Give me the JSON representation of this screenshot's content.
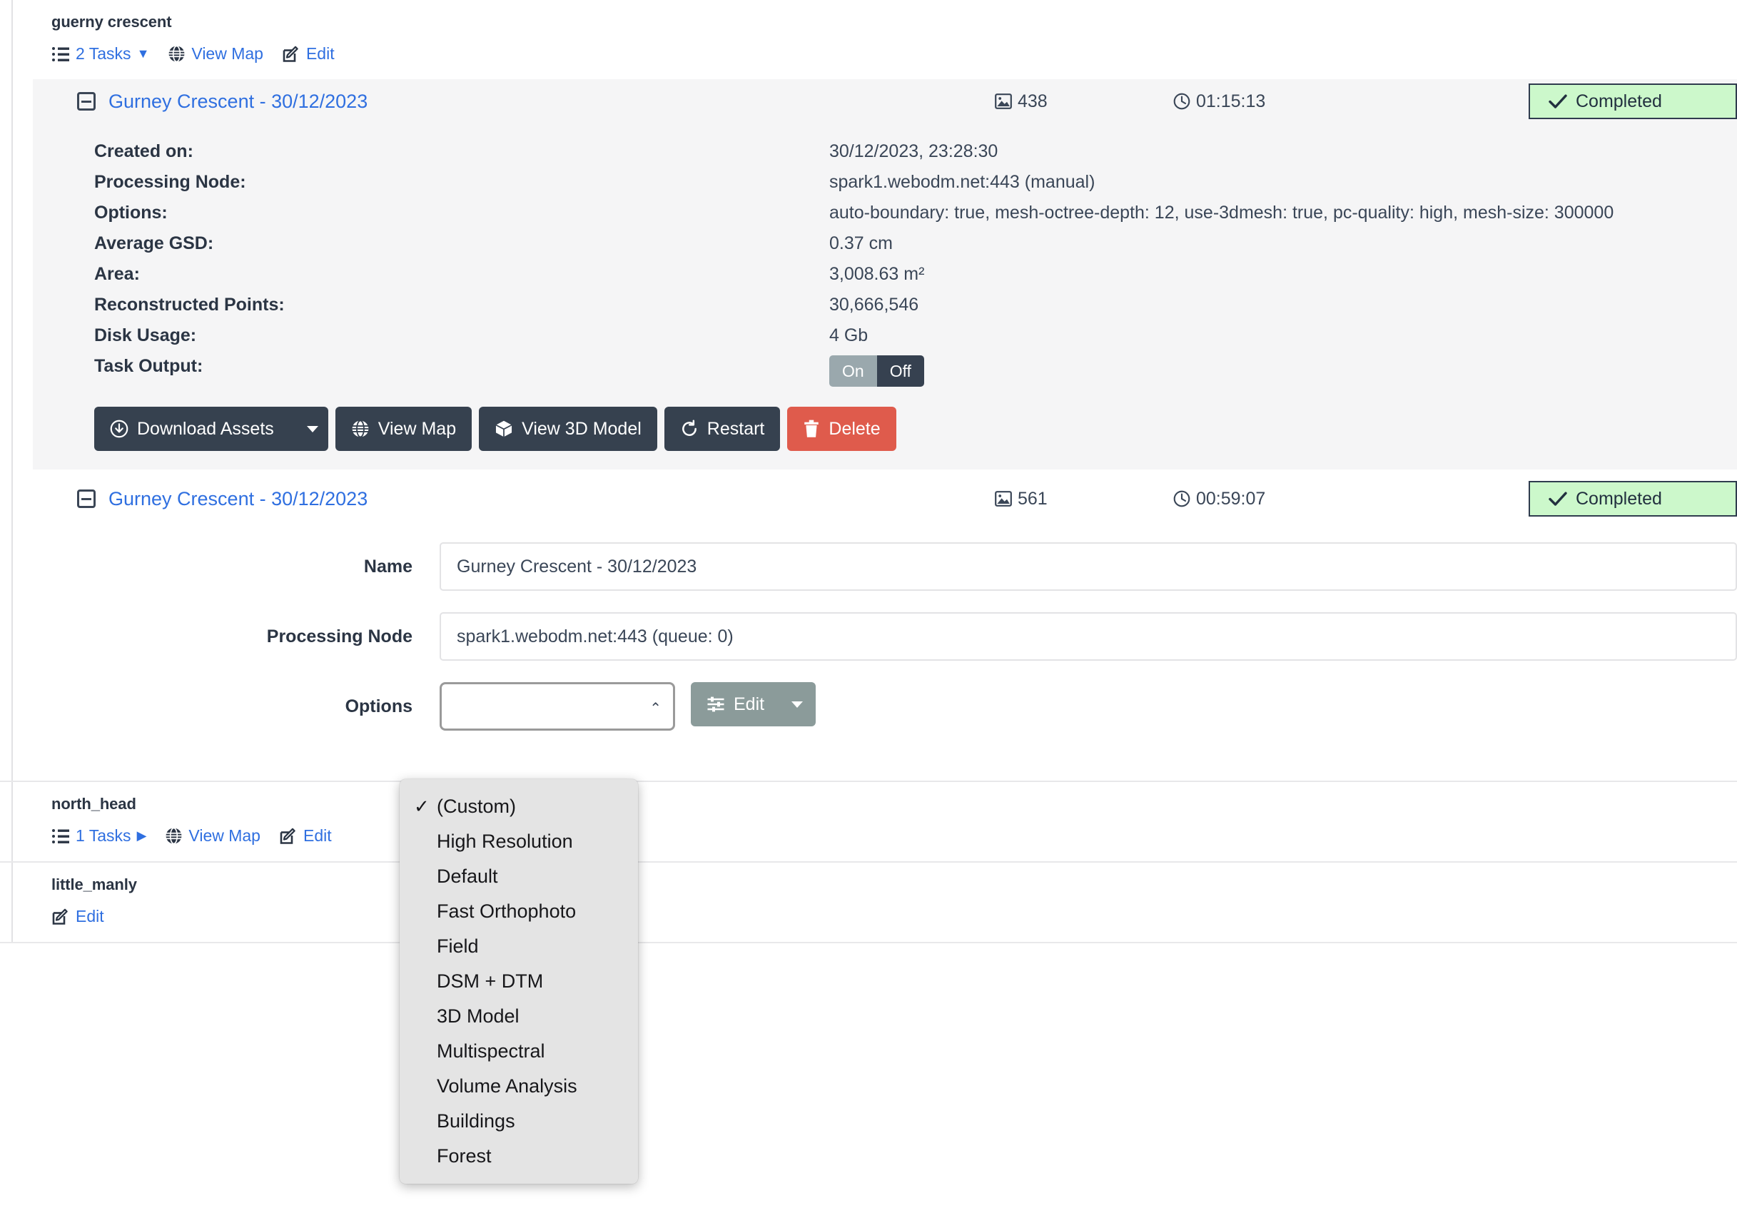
{
  "projects": [
    {
      "name": "guerny crescent",
      "tasks_label": "2 Tasks",
      "tasks_caret": "▼",
      "view_map_label": "View Map",
      "edit_label": "Edit",
      "expanded": true
    },
    {
      "name": "north_head",
      "tasks_label": "1 Tasks",
      "tasks_caret": "▶",
      "view_map_label": "View Map",
      "edit_label": "Edit",
      "expanded": false
    },
    {
      "name": "little_manly",
      "edit_label": "Edit"
    }
  ],
  "task_one": {
    "title": "Gurney Crescent - 30/12/2023",
    "image_count": "438",
    "duration": "01:15:13",
    "status": "Completed",
    "status_color": "#ccf8cb",
    "details": [
      {
        "label": "Created on:",
        "value": "30/12/2023, 23:28:30"
      },
      {
        "label": "Processing Node:",
        "value": "spark1.webodm.net:443 (manual)"
      },
      {
        "label": "Options:",
        "value": "auto-boundary: true, mesh-octree-depth: 12, use-3dmesh: true, pc-quality: high, mesh-size: 300000"
      },
      {
        "label": "Average GSD:",
        "value": "0.37 cm"
      },
      {
        "label": "Area:",
        "value": "3,008.63 m²"
      },
      {
        "label": "Reconstructed Points:",
        "value": "30,666,546"
      },
      {
        "label": "Disk Usage:",
        "value": "4 Gb"
      }
    ],
    "task_output_label": "Task Output:",
    "toggle": {
      "on_label": "On",
      "off_label": "Off",
      "selected": "Off"
    },
    "buttons": [
      {
        "label": "Download Assets",
        "icon": "download-icon",
        "split": true,
        "style": "dark"
      },
      {
        "label": "View Map",
        "icon": "globe-icon",
        "style": "dark"
      },
      {
        "label": "View 3D Model",
        "icon": "cube-icon",
        "style": "dark"
      },
      {
        "label": "Restart",
        "icon": "restart-icon",
        "style": "dark"
      },
      {
        "label": "Delete",
        "icon": "trash-icon",
        "style": "danger"
      }
    ]
  },
  "task_two": {
    "title": "Gurney Crescent - 30/12/2023",
    "image_count": "561",
    "duration": "00:59:07",
    "status": "Completed",
    "status_color": "#ccf8cb",
    "form": {
      "name_label": "Name",
      "name_value": "Gurney Crescent - 30/12/2023",
      "name_placeholder": "Name",
      "node_label": "Processing Node",
      "node_value": "spark1.webodm.net:443 (queue: 0)",
      "options_label": "Options",
      "edit_button_label": "Edit"
    }
  },
  "dropdown": {
    "selected": "(Custom)",
    "items": [
      "(Custom)",
      "High Resolution",
      "Default",
      "Fast Orthophoto",
      "Field",
      "DSM + DTM",
      "3D Model",
      "Multispectral",
      "Volume Analysis",
      "Buildings",
      "Forest"
    ]
  }
}
